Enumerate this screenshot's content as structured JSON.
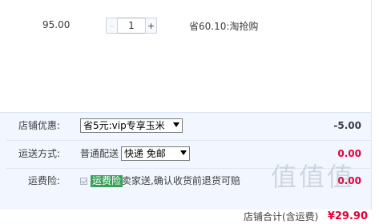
{
  "item": {
    "price": "95.00",
    "quantity": "1",
    "minus_label": "-",
    "plus_label": "+",
    "saving": "省60.10:淘抢购"
  },
  "order": {
    "discount": {
      "label": "店铺优惠:",
      "selected": "省5元:vip专享玉米",
      "amount": "-5.00"
    },
    "shipping": {
      "label": "运送方式:",
      "method": "普通配送",
      "selected": "快递 免邮",
      "amount": "0.00"
    },
    "insurance": {
      "label": "运费险:",
      "checked": true,
      "tag": "运费险",
      "desc": "卖家送,确认收货前退货可赔",
      "amount": "0.00"
    }
  },
  "total": {
    "label": "店铺合计(含运费)",
    "amount": "¥29.90"
  },
  "watermark": "值值值",
  "colors": {
    "accent_red": "#e4003a",
    "panel_bg": "#f2f7ff",
    "insurance_tag": "#3a9f5b"
  }
}
